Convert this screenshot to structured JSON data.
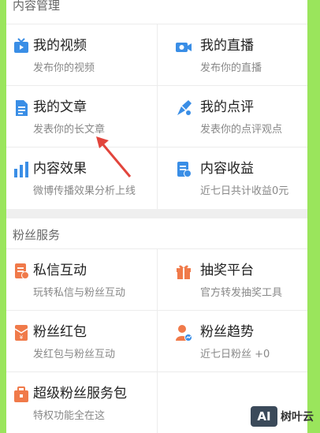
{
  "sections": {
    "content_mgmt_title": "内容管理",
    "fans_title": "粉丝服务"
  },
  "content": [
    {
      "left": {
        "title": "我的视频",
        "sub": "发布你的视频",
        "icon": "video-icon"
      },
      "right": {
        "title": "我的直播",
        "sub": "发布你的直播",
        "icon": "camera-icon"
      }
    },
    {
      "left": {
        "title": "我的文章",
        "sub": "发表你的长文章",
        "icon": "document-icon"
      },
      "right": {
        "title": "我的点评",
        "sub": "发表你的点评观点",
        "icon": "pen-star-icon"
      }
    },
    {
      "left": {
        "title": "内容效果",
        "sub": "微博传播效果分析上线",
        "icon": "bar-chart-icon"
      },
      "right": {
        "title": "内容收益",
        "sub": "近七日共计收益0元",
        "icon": "income-doc-icon"
      }
    }
  ],
  "fans": [
    {
      "left": {
        "title": "私信互动",
        "sub": "玩转私信与粉丝互动",
        "icon": "message-doc-icon"
      },
      "right": {
        "title": "抽奖平台",
        "sub": "官方转发抽奖工具",
        "icon": "gift-box-icon"
      }
    },
    {
      "left": {
        "title": "粉丝红包",
        "sub": "发红包与粉丝互动",
        "icon": "red-envelope-icon"
      },
      "right": {
        "title": "粉丝趋势",
        "sub": "近七日粉丝 +0",
        "icon": "user-trend-icon"
      }
    },
    {
      "left": {
        "title": "超级粉丝服务包",
        "sub": "特权功能全在这",
        "icon": "service-bag-icon"
      },
      "right": {
        "title": "",
        "sub": "",
        "icon": ""
      }
    }
  ],
  "logo": {
    "badge": "AI",
    "name": "树叶云"
  },
  "colors": {
    "blue": "#3a8ee6",
    "orange": "#f07a4a",
    "red": "#e2453c",
    "border": "#9ae55c"
  }
}
